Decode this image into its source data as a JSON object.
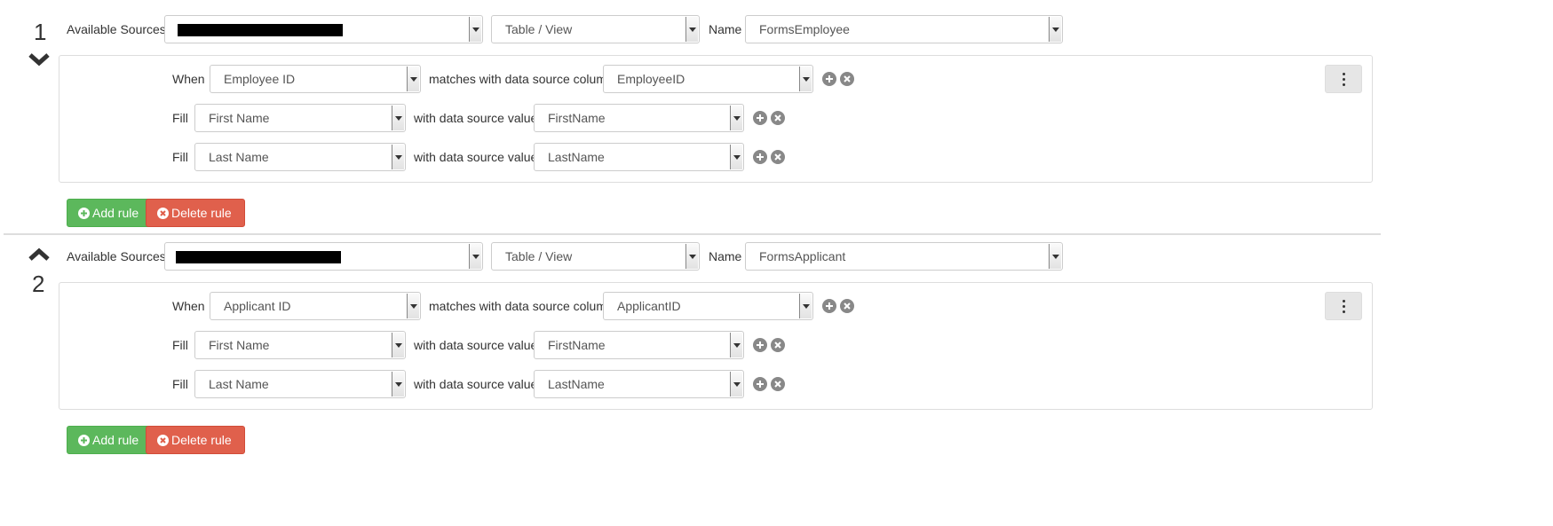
{
  "colors": {
    "add_button": "#5cb85c",
    "delete_button": "#e0604c",
    "icon_gray": "#888888"
  },
  "sections": [
    {
      "number": "1",
      "toggle_icon": "chevron-down-icon",
      "sources_label": "Available Sources",
      "source_value": "",
      "type_value": "Table / View",
      "name_label": "Name",
      "name_value": "FormsEmployee",
      "when_label": "When",
      "when_field": "Employee ID",
      "matches_label": "matches with data source column",
      "match_column": "EmployeeID",
      "fills": [
        {
          "label": "Fill",
          "field": "First Name",
          "with_label": "with data source value",
          "value": "FirstName"
        },
        {
          "label": "Fill",
          "field": "Last Name",
          "with_label": "with data source value",
          "value": "LastName"
        }
      ],
      "add_rule": "Add rule",
      "delete_rule": "Delete rule"
    },
    {
      "number": "2",
      "toggle_icon": "chevron-up-icon",
      "sources_label": "Available Sources",
      "source_value": "",
      "type_value": "Table / View",
      "name_label": "Name",
      "name_value": "FormsApplicant",
      "when_label": "When",
      "when_field": "Applicant ID",
      "matches_label": "matches with data source column",
      "match_column": "ApplicantID",
      "fills": [
        {
          "label": "Fill",
          "field": "First Name",
          "with_label": "with data source value",
          "value": "FirstName"
        },
        {
          "label": "Fill",
          "field": "Last Name",
          "with_label": "with data source value",
          "value": "LastName"
        }
      ],
      "add_rule": "Add rule",
      "delete_rule": "Delete rule"
    }
  ]
}
